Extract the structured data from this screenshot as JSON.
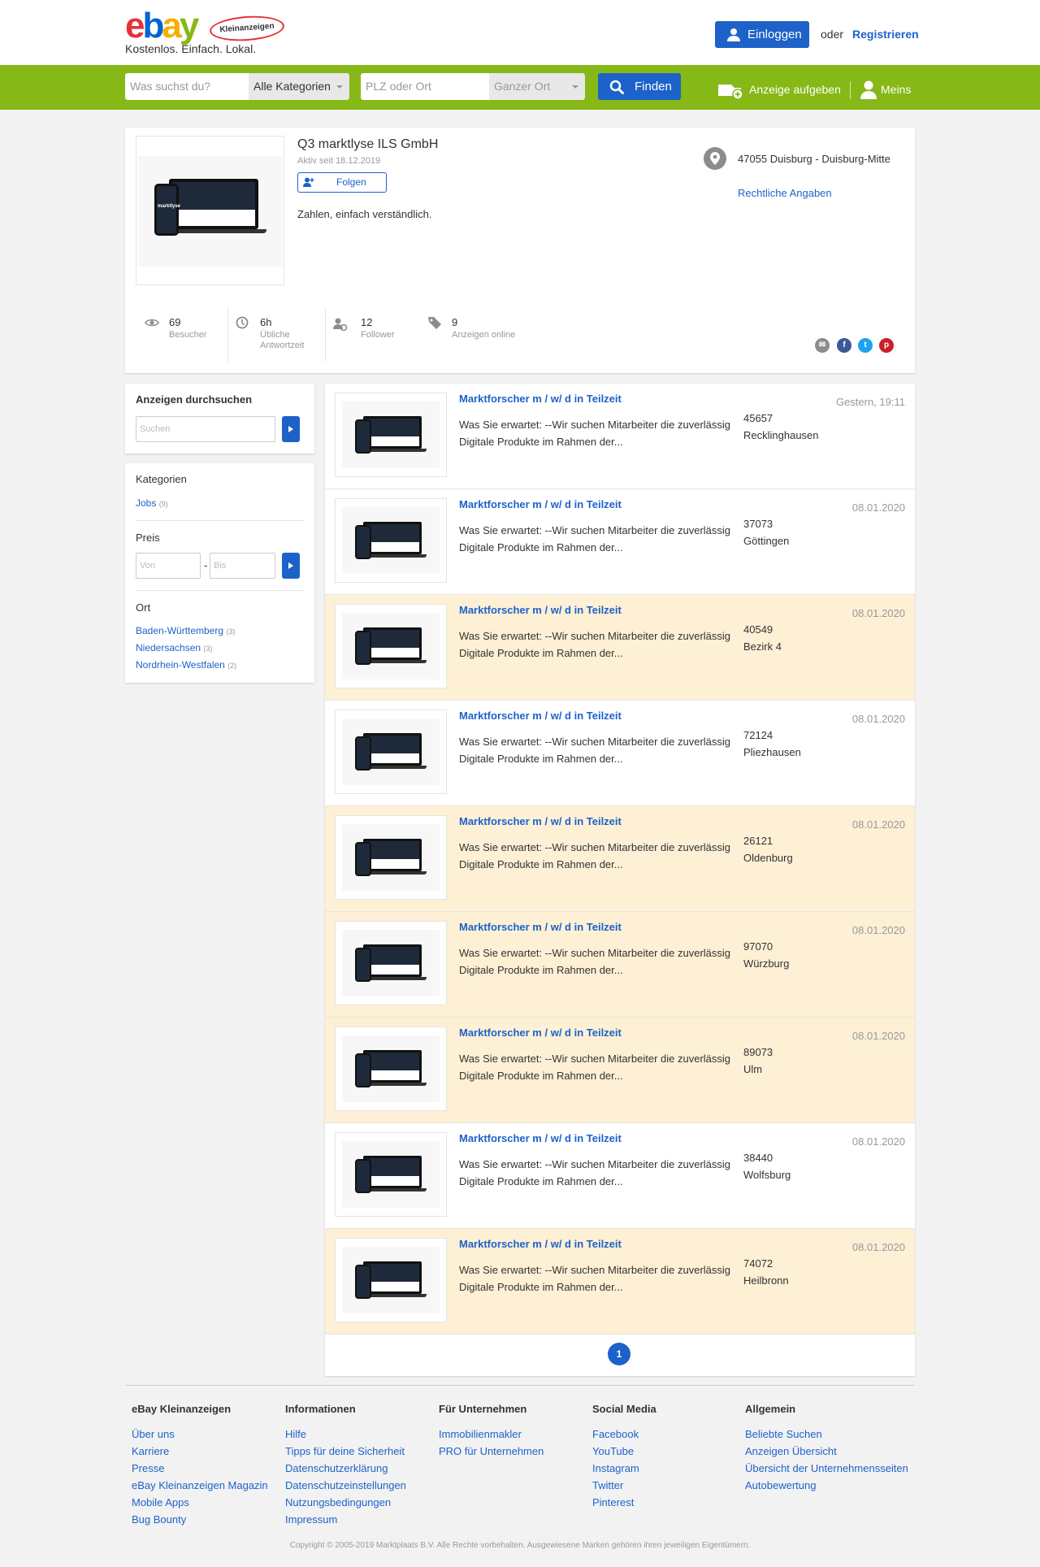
{
  "header": {
    "logo_text": "ebay",
    "logo_badge": "Kleinanzeigen",
    "tagline": "Kostenlos. Einfach. Lokal.",
    "login_label": "Einloggen",
    "or_text": "oder",
    "register_label": "Registrieren"
  },
  "searchbar": {
    "query_placeholder": "Was suchst du?",
    "category_value": "Alle Kategorien",
    "location_placeholder": "PLZ oder Ort",
    "radius_value": "Ganzer Ort",
    "find_label": "Finden",
    "post_ad_label": "Anzeige aufgeben",
    "meins_label": "Meins"
  },
  "profile": {
    "name": "Q3 marktlyse ILS GmbH",
    "since": "Aktiv seit 18.12.2019",
    "follow_label": "Folgen",
    "description": "Zahlen, einfach verständlich.",
    "location": "47055 Duisburg - Duisburg-Mitte",
    "legal_link": "Rechtliche Angaben",
    "brand_text": "marktlyse",
    "stats": [
      {
        "value": "69",
        "label": "Besucher",
        "icon": "eye-icon"
      },
      {
        "value": "6h",
        "label": "Übliche Antwortzeit",
        "icon": "clock-icon"
      },
      {
        "value": "12",
        "label": "Follower",
        "icon": "follower-icon"
      },
      {
        "value": "9",
        "label": "Anzeigen online",
        "icon": "tag-icon"
      }
    ],
    "share": [
      {
        "name": "email",
        "color": "#8c8c8c"
      },
      {
        "name": "facebook",
        "color": "#3b5998"
      },
      {
        "name": "twitter",
        "color": "#1da1f2"
      },
      {
        "name": "pinterest",
        "color": "#cb2027"
      }
    ]
  },
  "sidebar": {
    "search_title": "Anzeigen durchsuchen",
    "search_placeholder": "Suchen",
    "categories_title": "Kategorien",
    "categories": [
      {
        "label": "Jobs",
        "count": "(9)"
      }
    ],
    "price_title": "Preis",
    "price_from_placeholder": "Von",
    "price_dash": "-",
    "price_to_placeholder": "Bis",
    "location_title": "Ort",
    "locations": [
      {
        "label": "Baden-Württemberg",
        "count": "(3)"
      },
      {
        "label": "Niedersachsen",
        "count": "(3)"
      },
      {
        "label": "Nordrhein-Westfalen",
        "count": "(2)"
      }
    ]
  },
  "listings": [
    {
      "title": "Marktforscher m / w/ d in Teilzeit",
      "desc": "Was Sie erwartet: --Wir suchen Mitarbeiter die zuverlässig Digitale Produkte im Rahmen der...",
      "zip": "45657",
      "city": "Recklinghausen",
      "date": "Gestern, 19:11",
      "highlight": false
    },
    {
      "title": "Marktforscher m / w/ d in Teilzeit",
      "desc": "Was Sie erwartet: --Wir suchen Mitarbeiter die zuverlässig Digitale Produkte im Rahmen der...",
      "zip": "37073",
      "city": "Göttingen",
      "date": "08.01.2020",
      "highlight": false
    },
    {
      "title": "Marktforscher m / w/ d in Teilzeit",
      "desc": "Was Sie erwartet: --Wir suchen Mitarbeiter die zuverlässig Digitale Produkte im Rahmen der...",
      "zip": "40549",
      "city": "Bezirk 4",
      "date": "08.01.2020",
      "highlight": true
    },
    {
      "title": "Marktforscher m / w/ d in Teilzeit",
      "desc": "Was Sie erwartet: --Wir suchen Mitarbeiter die zuverlässig Digitale Produkte im Rahmen der...",
      "zip": "72124",
      "city": "Pliezhausen",
      "date": "08.01.2020",
      "highlight": false
    },
    {
      "title": "Marktforscher m / w/ d in Teilzeit",
      "desc": "Was Sie erwartet: --Wir suchen Mitarbeiter die zuverlässig Digitale Produkte im Rahmen der...",
      "zip": "26121",
      "city": "Oldenburg",
      "date": "08.01.2020",
      "highlight": true
    },
    {
      "title": "Marktforscher m / w/ d in Teilzeit",
      "desc": "Was Sie erwartet: --Wir suchen Mitarbeiter die zuverlässig Digitale Produkte im Rahmen der...",
      "zip": "97070",
      "city": "Würzburg",
      "date": "08.01.2020",
      "highlight": true
    },
    {
      "title": "Marktforscher m / w/ d in Teilzeit",
      "desc": "Was Sie erwartet: --Wir suchen Mitarbeiter die zuverlässig Digitale Produkte im Rahmen der...",
      "zip": "89073",
      "city": "Ulm",
      "date": "08.01.2020",
      "highlight": true
    },
    {
      "title": "Marktforscher m / w/ d in Teilzeit",
      "desc": "Was Sie erwartet: --Wir suchen Mitarbeiter die zuverlässig Digitale Produkte im Rahmen der...",
      "zip": "38440",
      "city": "Wolfsburg",
      "date": "08.01.2020",
      "highlight": false
    },
    {
      "title": "Marktforscher m / w/ d in Teilzeit",
      "desc": "Was Sie erwartet: --Wir suchen Mitarbeiter die zuverlässig Digitale Produkte im Rahmen der...",
      "zip": "74072",
      "city": "Heilbronn",
      "date": "08.01.2020",
      "highlight": true
    }
  ],
  "pagination": {
    "current": "1"
  },
  "footer": {
    "columns": [
      {
        "title": "eBay Kleinanzeigen",
        "links": [
          "Über uns",
          "Karriere",
          "Presse",
          "eBay Kleinanzeigen Magazin",
          "Mobile Apps",
          "Bug Bounty"
        ]
      },
      {
        "title": "Informationen",
        "links": [
          "Hilfe",
          "Tipps für deine Sicherheit",
          "Datenschutzerklärung",
          "Datenschutzeinstellungen",
          "Nutzungsbedingungen",
          "Impressum"
        ]
      },
      {
        "title": "Für Unternehmen",
        "links": [
          "Immobilienmakler",
          "PRO für Unternehmen"
        ]
      },
      {
        "title": "Social Media",
        "links": [
          "Facebook",
          "YouTube",
          "Instagram",
          "Twitter",
          "Pinterest"
        ]
      },
      {
        "title": "Allgemein",
        "links": [
          "Beliebte Suchen",
          "Anzeigen Übersicht",
          "Übersicht der Unternehmensseiten",
          "Autobewertung"
        ]
      }
    ],
    "copyright": "Copyright © 2005-2019 Marktplaats B.V. Alle Rechte vorbehalten. Ausgewiesene Marken gehören ihren jeweiligen Eigentümern."
  },
  "colors": {
    "brand_green": "#86b817",
    "primary_blue": "#1d62c9",
    "highlight_row": "#fdf0d5"
  }
}
